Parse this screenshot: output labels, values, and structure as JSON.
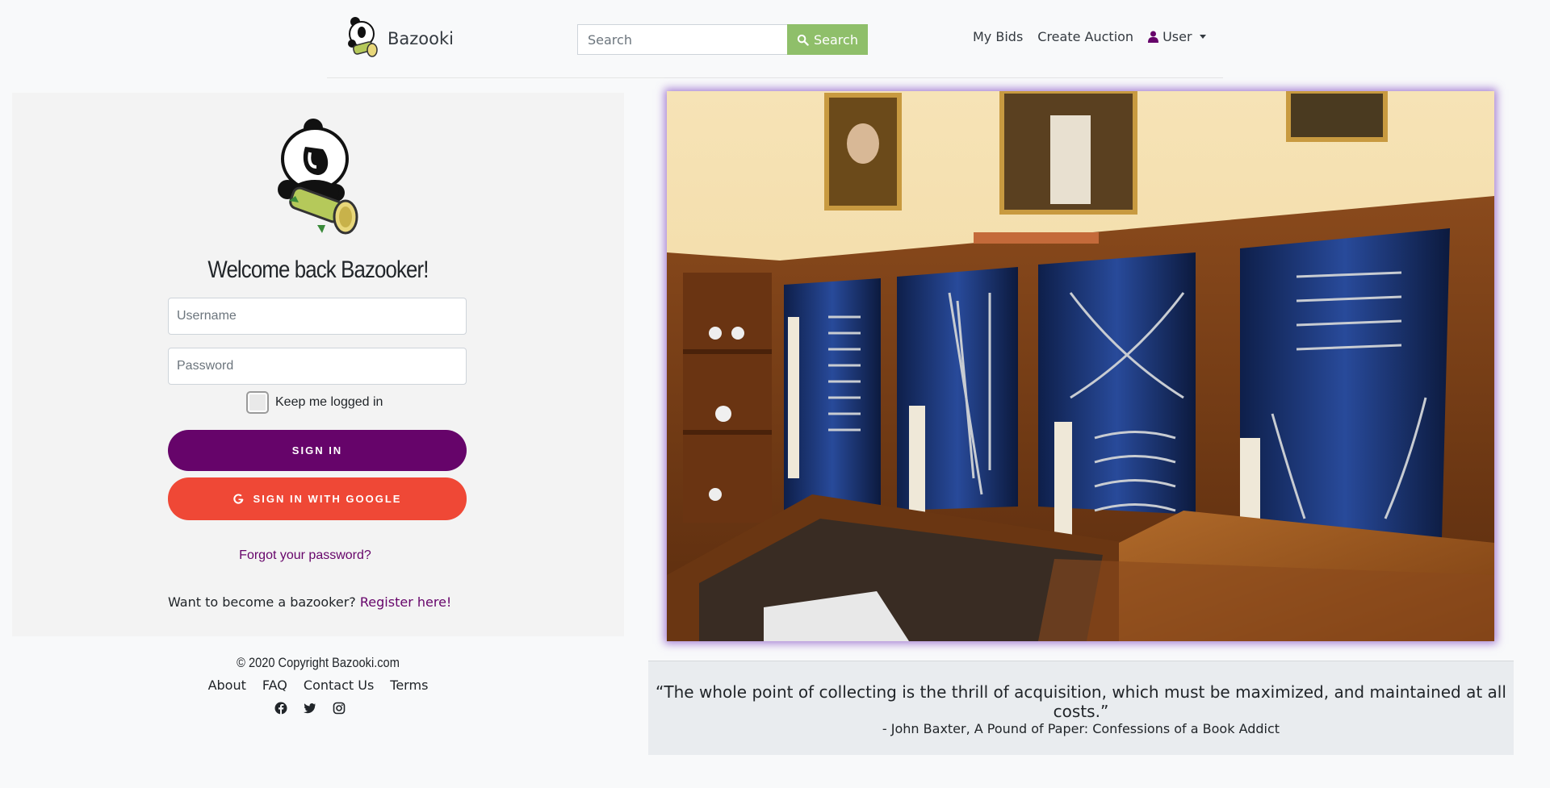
{
  "navbar": {
    "brand": "Bazooki",
    "search_placeholder": "Search",
    "search_button": "Search",
    "links": [
      "My Bids",
      "Create Auction"
    ],
    "user_menu": "User"
  },
  "login": {
    "welcome": "Welcome back Bazooker!",
    "username_placeholder": "Username",
    "password_placeholder": "Password",
    "remember_label": "Keep me logged in",
    "signin_button": "SIGN IN",
    "google_button": "SIGN IN WITH GOOGLE",
    "forgot": "Forgot your password?",
    "register_prompt": "Want to become a bazooker?",
    "register_link": "Register here!"
  },
  "footer": {
    "copyright": "© 2020 Copyright Bazooki.com",
    "links": [
      "About",
      "FAQ",
      "Contact Us",
      "Terms"
    ],
    "socials": [
      "facebook-icon",
      "twitter-icon",
      "instagram-icon"
    ]
  },
  "quote": {
    "text": "“The whole point of collecting is the thrill of acquisition, which must be maximized, and maintained at all costs.”",
    "author": "- John Baxter, A Pound of Paper: Confessions of a Book Addict"
  },
  "colors": {
    "brand_purple": "#66046a",
    "google_red": "#ef4836",
    "search_green": "#8fbf6a"
  }
}
